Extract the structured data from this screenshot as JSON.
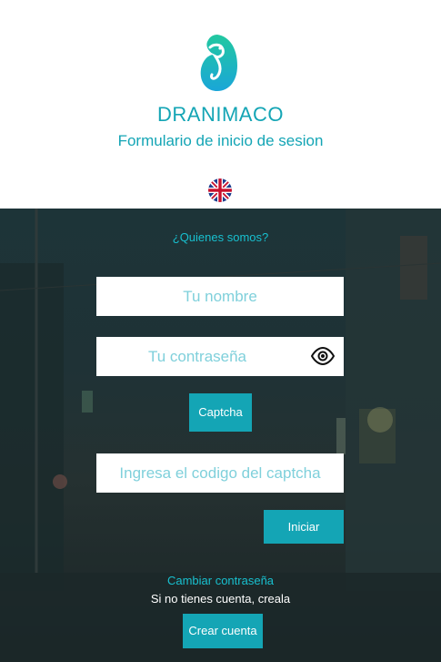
{
  "header": {
    "brand": "DRANIMACO",
    "subtitle": "Formulario de inicio de sesion",
    "logo_icon": "dragon-logo-icon",
    "language_icon": "uk-flag-icon"
  },
  "form": {
    "about_link": "¿Quienes somos?",
    "username_placeholder": "Tu nombre",
    "password_placeholder": "Tu contraseña",
    "password_toggle_icon": "eye-icon",
    "captcha_button": "Captcha",
    "captcha_placeholder": "Ingresa el codigo del captcha",
    "login_button": "Iniciar",
    "change_password_link": "Cambiar contraseña",
    "no_account_text": "Si no tienes cuenta, creala",
    "create_account_button": "Crear cuenta"
  },
  "colors": {
    "accent": "#14a5b5",
    "link": "#18c0cf",
    "background_dark": "#1f3236"
  }
}
